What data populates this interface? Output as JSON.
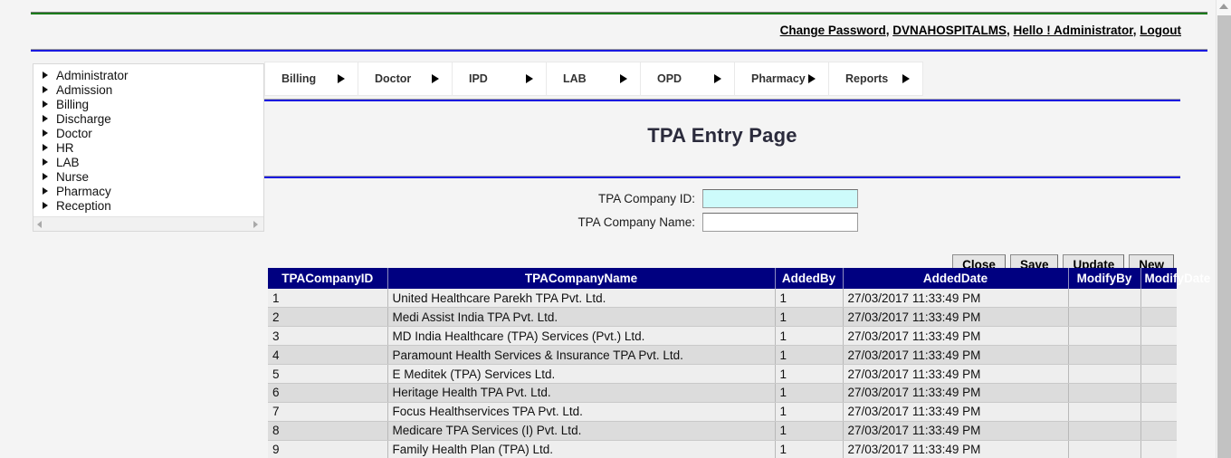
{
  "header": {
    "links": [
      {
        "label": "Change Password",
        "name": "change-password-link"
      },
      {
        "label": "DVNAHOSPITALMS",
        "name": "org-link"
      },
      {
        "label": "Hello ! Administrator",
        "name": "user-greeting-link"
      },
      {
        "label": "Logout",
        "name": "logout-link"
      }
    ],
    "separator": ", "
  },
  "sidebar": {
    "items": [
      {
        "label": "Administrator"
      },
      {
        "label": "Admission"
      },
      {
        "label": "Billing"
      },
      {
        "label": "Discharge"
      },
      {
        "label": "Doctor"
      },
      {
        "label": "HR"
      },
      {
        "label": "LAB"
      },
      {
        "label": "Nurse"
      },
      {
        "label": "Pharmacy"
      },
      {
        "label": "Reception"
      }
    ]
  },
  "nav": {
    "items": [
      {
        "label": "Billing"
      },
      {
        "label": "Doctor"
      },
      {
        "label": "IPD"
      },
      {
        "label": "LAB"
      },
      {
        "label": "OPD"
      },
      {
        "label": "Pharmacy"
      },
      {
        "label": "Reports"
      }
    ]
  },
  "main": {
    "title": "TPA Entry Page",
    "form": {
      "company_id": {
        "label": "TPA Company ID:",
        "value": "",
        "placeholder": ""
      },
      "company_name": {
        "label": "TPA Company Name:",
        "value": "",
        "placeholder": ""
      }
    },
    "buttons": [
      {
        "label": "Close"
      },
      {
        "label": "Save"
      },
      {
        "label": "Update"
      },
      {
        "label": "New"
      }
    ]
  },
  "grid": {
    "columns": [
      {
        "label": "TPACompanyID"
      },
      {
        "label": "TPACompanyName"
      },
      {
        "label": "AddedBy"
      },
      {
        "label": "AddedDate"
      },
      {
        "label": "ModifyBy"
      },
      {
        "label": "ModifyDate"
      }
    ],
    "rows": [
      {
        "id": "1",
        "name": "United Healthcare Parekh TPA Pvt. Ltd.",
        "added_by": "1",
        "added_date": "27/03/2017 11:33:49 PM",
        "modify_by": "",
        "modify_date": ""
      },
      {
        "id": "2",
        "name": "Medi Assist India TPA Pvt. Ltd.",
        "added_by": "1",
        "added_date": "27/03/2017 11:33:49 PM",
        "modify_by": "",
        "modify_date": ""
      },
      {
        "id": "3",
        "name": "MD India Healthcare (TPA) Services (Pvt.) Ltd.",
        "added_by": "1",
        "added_date": "27/03/2017 11:33:49 PM",
        "modify_by": "",
        "modify_date": ""
      },
      {
        "id": "4",
        "name": "Paramount Health Services & Insurance TPA Pvt. Ltd.",
        "added_by": "1",
        "added_date": "27/03/2017 11:33:49 PM",
        "modify_by": "",
        "modify_date": ""
      },
      {
        "id": "5",
        "name": "E Meditek (TPA) Services Ltd.",
        "added_by": "1",
        "added_date": "27/03/2017 11:33:49 PM",
        "modify_by": "",
        "modify_date": ""
      },
      {
        "id": "6",
        "name": "Heritage Health TPA Pvt. Ltd.",
        "added_by": "1",
        "added_date": "27/03/2017 11:33:49 PM",
        "modify_by": "",
        "modify_date": ""
      },
      {
        "id": "7",
        "name": "Focus Healthservices TPA Pvt. Ltd.",
        "added_by": "1",
        "added_date": "27/03/2017 11:33:49 PM",
        "modify_by": "",
        "modify_date": ""
      },
      {
        "id": "8",
        "name": "Medicare TPA Services (I) Pvt. Ltd.",
        "added_by": "1",
        "added_date": "27/03/2017 11:33:49 PM",
        "modify_by": "",
        "modify_date": ""
      },
      {
        "id": "9",
        "name": "Family Health Plan (TPA) Ltd.",
        "added_by": "1",
        "added_date": "27/03/2017 11:33:49 PM",
        "modify_by": "",
        "modify_date": ""
      }
    ]
  },
  "colors": {
    "grid_header": "#000080",
    "rule_blue": "#1a1ae0",
    "rule_green": "#1a7a1a",
    "highlight_field": "#cdfbfb"
  }
}
